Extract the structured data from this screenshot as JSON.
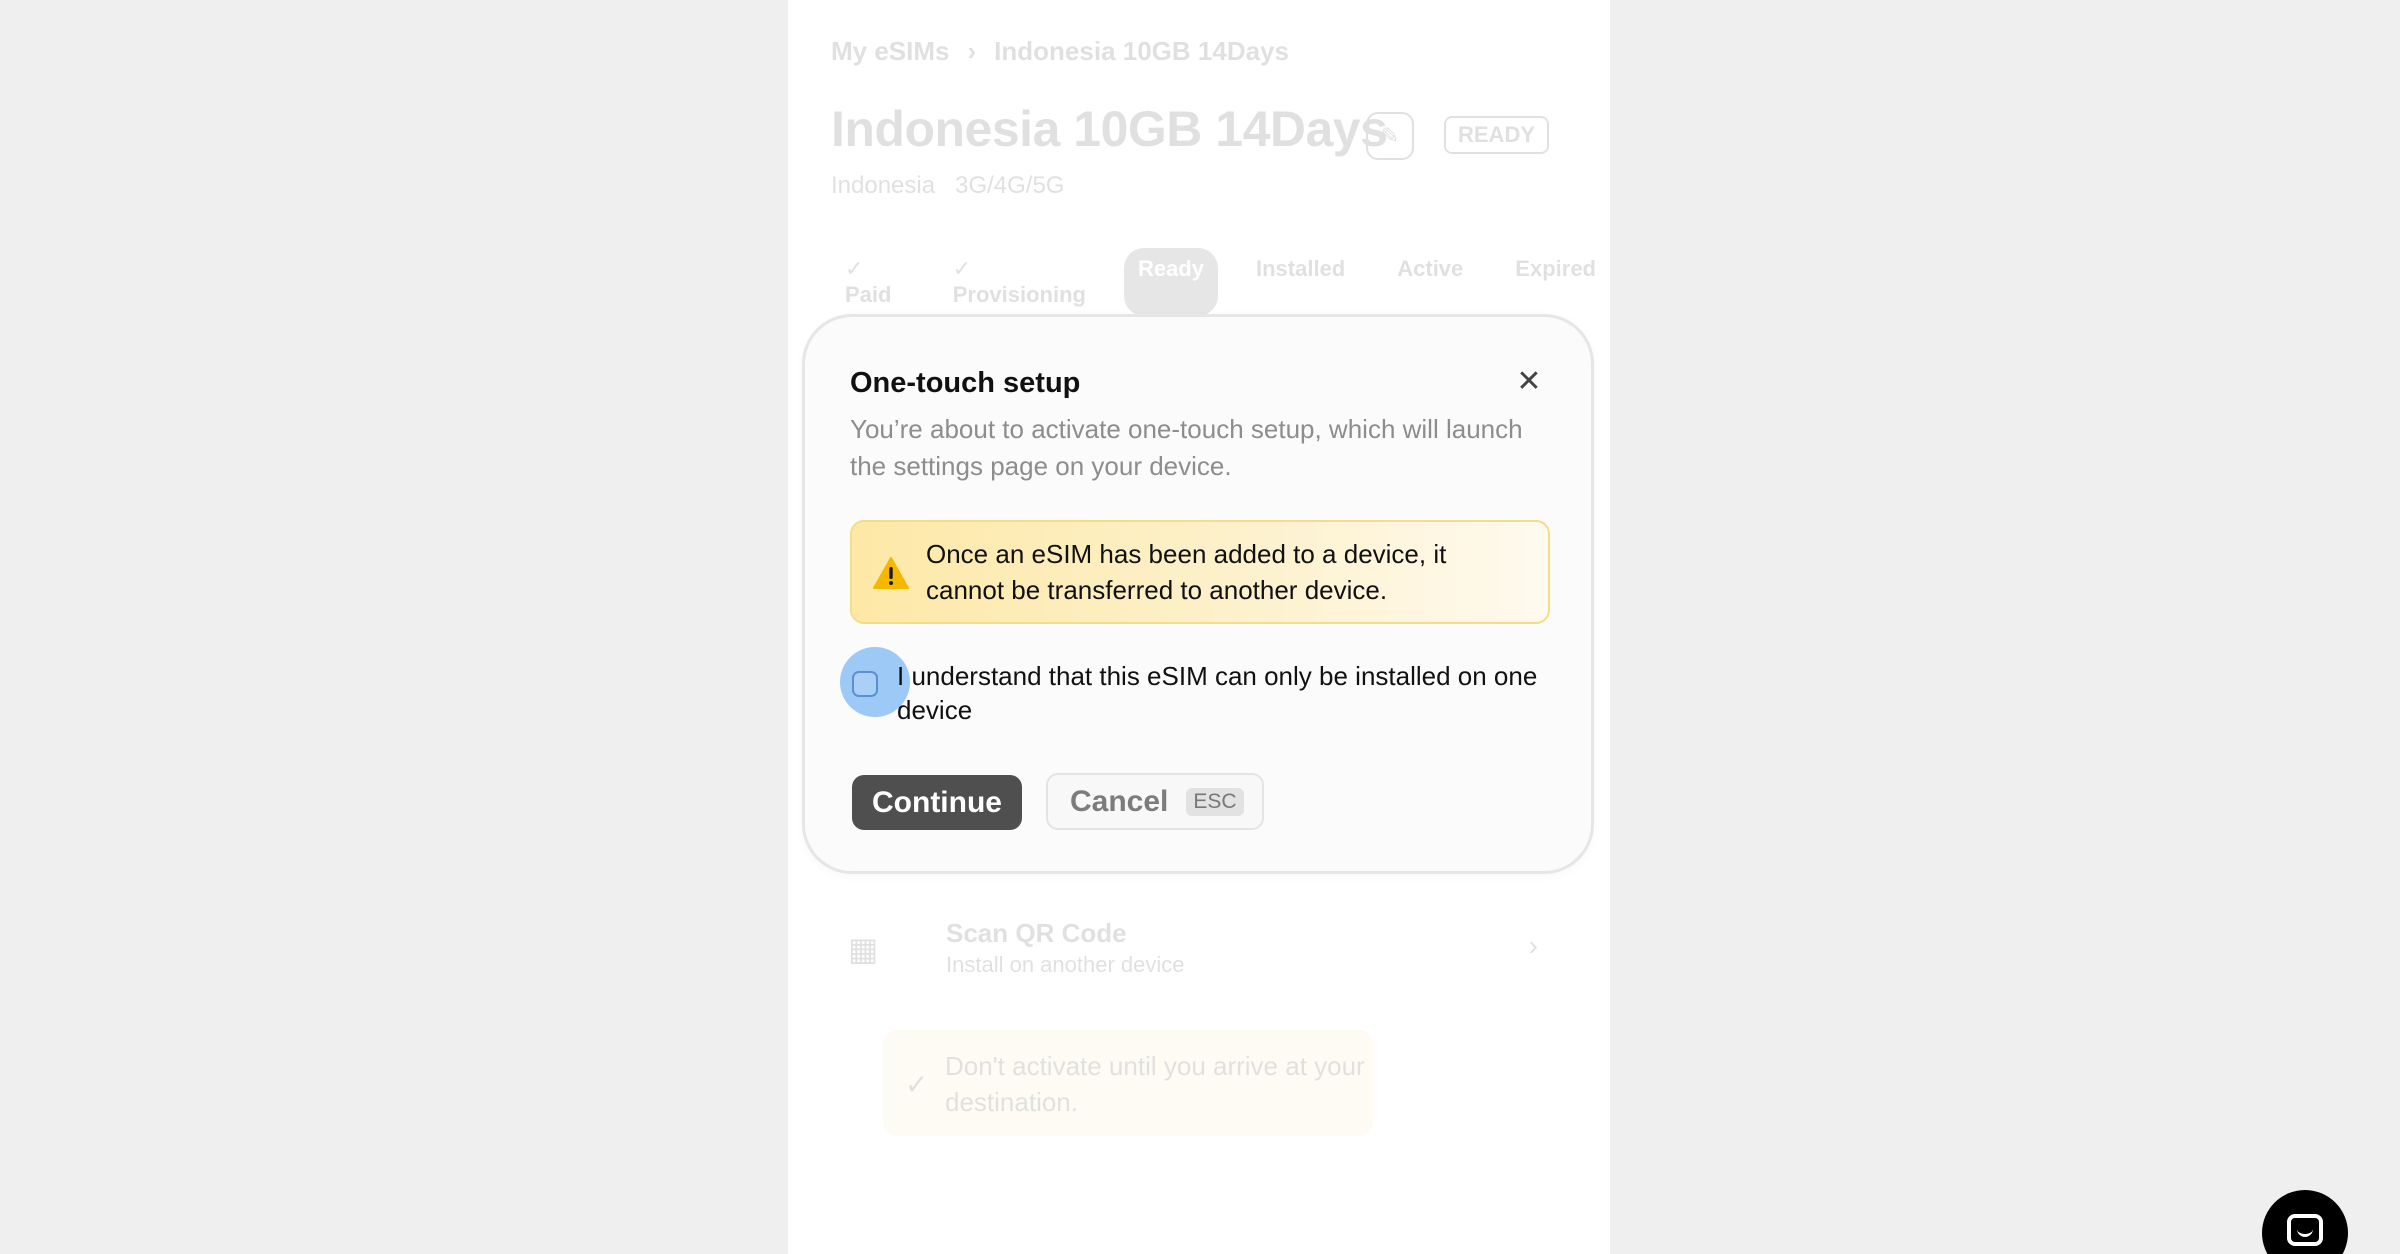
{
  "background": {
    "breadcrumb": {
      "parent": "My eSIMs",
      "separator": "›",
      "current": "Indonesia 10GB 14Days"
    },
    "title": "Indonesia 10GB 14Days",
    "edit_icon": "pencil-icon",
    "status_badge": "READY",
    "country": "Indonesia",
    "network": "3G/4G/5G",
    "steps": [
      {
        "label": "✓ Paid"
      },
      {
        "label": "✓ Provisioning"
      },
      {
        "label": "Ready"
      },
      {
        "label": "Installed"
      },
      {
        "label": "Active"
      },
      {
        "label": "Expired"
      }
    ],
    "scan": {
      "icon": "qr-code-icon",
      "title": "Scan QR Code",
      "subtitle": "Install on another device",
      "chevron": "›"
    },
    "tip": {
      "icon": "check-icon",
      "text": "Don't activate until you arrive at your destination."
    }
  },
  "modal": {
    "title": "One-touch setup",
    "close_icon": "close-icon",
    "close_glyph": "✕",
    "description": "You’re about to activate one-touch setup, which will launch the settings page on your device.",
    "warning": {
      "icon": "warning-icon",
      "text": "Once an eSIM has been added to a device, it cannot be transferred to another device."
    },
    "checkbox": {
      "checked": false,
      "label": "I understand that this eSIM can only be installed on one device"
    },
    "buttons": {
      "continue": "Continue",
      "cancel": "Cancel",
      "cancel_shortcut": "ESC"
    }
  },
  "chat_button": {
    "icon": "chat-icon"
  },
  "colors": {
    "continue_bg": "#4f4f4f",
    "warning_border": "#f3dd86",
    "warning_bg": "#fde8a6",
    "checkbox_highlight": "#9cc9f6"
  }
}
